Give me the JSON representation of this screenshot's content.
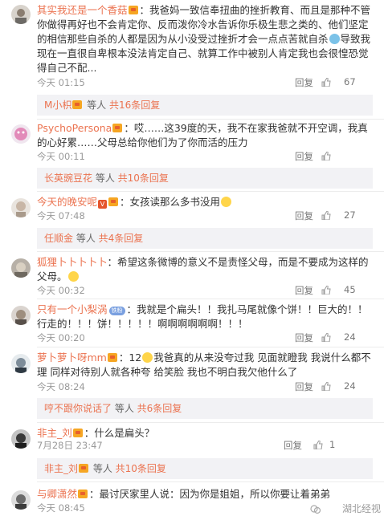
{
  "comments": [
    {
      "username": "其实我还是一个香菇",
      "badge": "level",
      "text": "：我爸妈一致信奉扭曲的挫折教育、而且是那种不管你做得再好也不会肯定你、反而泼你冷水告诉你乐极生悲之类的、他们坚定的相信那些自杀的人都是因为从小没受过挫折才会一点点苦就自杀",
      "text_after_emoji": "导致我现在一直很自卑根本没法肯定自己、就算工作中被别人肯定我也会很惶恐觉得自己不配...",
      "time": "今天 01:15",
      "reply_label": "回复",
      "likes": "67",
      "sub_user": "M小枳",
      "sub_text": " 等人 ",
      "sub_count": "共16条回复"
    },
    {
      "username": "PsychoPersona",
      "badge": "level",
      "text": "：哎……这39度的天，我不在家我爸就不开空调，我真的心好累……父母总给你他们为了你而活的压力",
      "time": "今天 00:11",
      "reply_label": "回复",
      "likes": "",
      "sub_user": "长英豌豆花",
      "sub_text": " 等人 ",
      "sub_count": "共10条回复"
    },
    {
      "username": "今天的晚安呢",
      "badge": "v",
      "text": "：女孩读那么多书没用",
      "time": "今天 07:48",
      "reply_label": "回复",
      "likes": "27",
      "sub_user": "任顺金",
      "sub_text": " 等人 ",
      "sub_count": "共4条回复"
    },
    {
      "username": "狐狸卜卜卜卜卜",
      "badge": "none",
      "text": "：希望这条微博的意义不是责怪父母，而是不要成为这样的父母。",
      "time": "今天 00:32",
      "reply_label": "回复",
      "likes": "45"
    },
    {
      "username": "只有一个小梨涡",
      "badge": "vip",
      "vip_label": "铁粉",
      "text": "：我就是个扁头！！我扎马尾就像个饼！！巨大的！！行走的！！！饼！！！！！啊啊啊啊啊啊！！！",
      "time": "今天 00:20",
      "reply_label": "回复",
      "likes": "24"
    },
    {
      "username": "萝卜萝卜呀mm",
      "badge": "level",
      "text": "：12",
      "text_after_emoji": "我爸真的从来没夸过我 见面就瞪我 我说什么都不理 同样对待别人就各种夸 给笑脸 我也不明白我欠他什么了",
      "time": "今天 08:24",
      "reply_label": "回复",
      "likes": "24",
      "sub_user": "哼不跟你说话了",
      "sub_text": " 等人 ",
      "sub_count": "共6条回复"
    },
    {
      "username": "非主_刘",
      "badge": "level",
      "text": "：什么是扁头？",
      "time": "7月28日 23:47",
      "reply_label": "回复",
      "likes": "1",
      "sub_user": "非主_刘",
      "sub_text": " 等人 ",
      "sub_count": "共10条回复"
    },
    {
      "username": "与卿潇然",
      "badge": "level",
      "text": "：最讨厌家里人说：因为你是姐姐，所以你要让着弟弟",
      "time": "今天 08:45",
      "reply_label": "回复",
      "likes": ""
    }
  ],
  "watermark": "湖北经视",
  "colors": {
    "username": "#eb7350",
    "subBackground": "#f2f2f5",
    "meta": "#9a9a9a"
  }
}
